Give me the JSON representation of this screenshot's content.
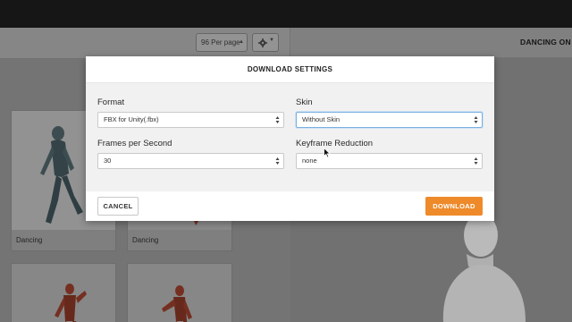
{
  "toolbar": {
    "per_page": "96 Per page",
    "animation_title": "DANCING ON M"
  },
  "grid": {
    "cards": [
      {
        "label": "Dancing"
      },
      {
        "label": "Dancing"
      },
      {
        "label": ""
      },
      {
        "label": ""
      }
    ]
  },
  "modal": {
    "title": "DOWNLOAD SETTINGS",
    "format_label": "Format",
    "format_value": "FBX for Unity(.fbx)",
    "skin_label": "Skin",
    "skin_value": "Without Skin",
    "fps_label": "Frames per Second",
    "fps_value": "30",
    "keyframe_label": "Keyframe Reduction",
    "keyframe_value": "none",
    "cancel_label": "CANCEL",
    "download_label": "DOWNLOAD"
  },
  "colors": {
    "download_button": "#ee8a2a",
    "topbar": "#1b1b1b",
    "focus_border": "#7bb0e0"
  },
  "icons": [
    "gear-icon",
    "chevron-down-icon",
    "select-arrows-icon",
    "mouse-cursor-icon",
    "character-figure"
  ]
}
